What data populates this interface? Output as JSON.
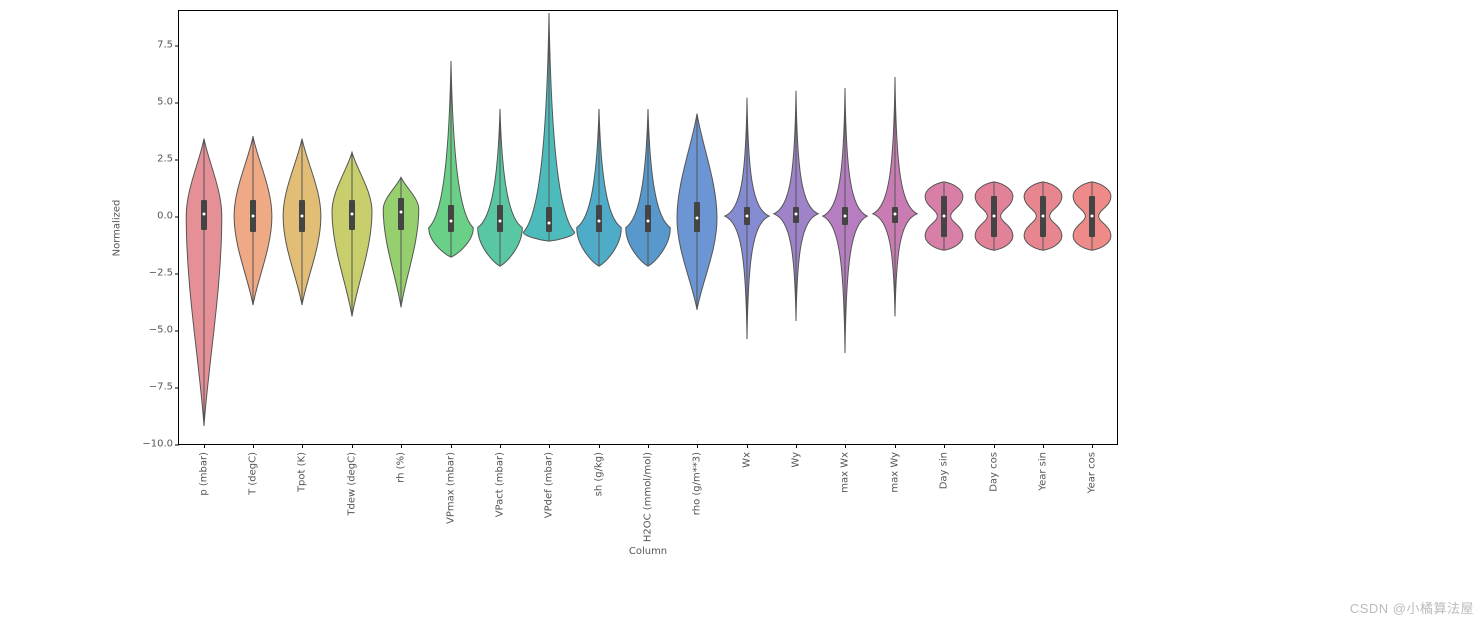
{
  "chart_data": {
    "type": "violin",
    "ylabel": "Normalized",
    "xlabel": "Column",
    "ylim": [
      -10,
      9
    ],
    "yticks": [
      -10.0,
      -7.5,
      -5.0,
      -2.5,
      0.0,
      2.5,
      5.0,
      7.5
    ],
    "ytick_labels": [
      "−10.0",
      "−7.5",
      "−5.0",
      "−2.5",
      "0.0",
      "2.5",
      "5.0",
      "7.5"
    ],
    "categories": [
      "p (mbar)",
      "T (degC)",
      "Tpot (K)",
      "Tdew (degC)",
      "rh (%)",
      "VPmax (mbar)",
      "VPact (mbar)",
      "VPdef (mbar)",
      "sh (g/kg)",
      "H2OC (mmol/mol)",
      "rho (g/m**3)",
      "Wx",
      "Wy",
      "max Wx",
      "max Wy",
      "Day sin",
      "Day cos",
      "Year sin",
      "Year cos"
    ],
    "series": [
      {
        "name": "p (mbar)",
        "color": "#e59097",
        "shape": "sym",
        "min": -9.2,
        "max": 3.4,
        "q1": -0.6,
        "q3": 0.7,
        "median": 0.1,
        "peak_y": 0.0,
        "bulge": 0.8
      },
      {
        "name": "T (degC)",
        "color": "#efa985",
        "shape": "sym",
        "min": -3.9,
        "max": 3.5,
        "q1": -0.7,
        "q3": 0.7,
        "median": 0.0,
        "peak_y": 0.0,
        "bulge": 0.85
      },
      {
        "name": "Tpot (K)",
        "color": "#e2bd76",
        "shape": "sym",
        "min": -3.9,
        "max": 3.4,
        "q1": -0.7,
        "q3": 0.7,
        "median": 0.0,
        "peak_y": 0.0,
        "bulge": 0.85
      },
      {
        "name": "Tdew (degC)",
        "color": "#c8ce6c",
        "shape": "sym",
        "min": -4.4,
        "max": 2.8,
        "q1": -0.6,
        "q3": 0.7,
        "median": 0.1,
        "peak_y": 0.2,
        "bulge": 0.9
      },
      {
        "name": "rh (%)",
        "color": "#96d06e",
        "shape": "sym",
        "min": -4.0,
        "max": 1.7,
        "q1": -0.6,
        "q3": 0.8,
        "median": 0.2,
        "peak_y": 0.3,
        "bulge": 0.8
      },
      {
        "name": "VPmax (mbar)",
        "color": "#6bd087",
        "shape": "lowfat",
        "min": -1.8,
        "max": 6.8,
        "q1": -0.7,
        "q3": 0.5,
        "median": -0.2,
        "peak_y": -0.5,
        "bulge": 1.0
      },
      {
        "name": "VPact (mbar)",
        "color": "#59c7a3",
        "shape": "lowfat",
        "min": -2.2,
        "max": 4.7,
        "q1": -0.7,
        "q3": 0.5,
        "median": -0.2,
        "peak_y": -0.5,
        "bulge": 1.0
      },
      {
        "name": "VPdef (mbar)",
        "color": "#4dbbbc",
        "shape": "lowfat2",
        "min": -1.1,
        "max": 8.9,
        "q1": -0.7,
        "q3": 0.4,
        "median": -0.3,
        "peak_y": -0.7,
        "bulge": 1.15
      },
      {
        "name": "sh (g/kg)",
        "color": "#4eacc8",
        "shape": "lowfat",
        "min": -2.2,
        "max": 4.7,
        "q1": -0.7,
        "q3": 0.5,
        "median": -0.2,
        "peak_y": -0.5,
        "bulge": 1.0
      },
      {
        "name": "H2OC (mmol/mol)",
        "color": "#5898cc",
        "shape": "lowfat",
        "min": -2.2,
        "max": 4.7,
        "q1": -0.7,
        "q3": 0.5,
        "median": -0.2,
        "peak_y": -0.5,
        "bulge": 1.0
      },
      {
        "name": "rho (g/m**3)",
        "color": "#6b95d3",
        "shape": "sym2",
        "min": -4.1,
        "max": 4.5,
        "q1": -0.7,
        "q3": 0.6,
        "median": -0.1,
        "peak_y": -0.1,
        "bulge": 0.9
      },
      {
        "name": "Wx",
        "color": "#858bd1",
        "shape": "center",
        "min": -5.4,
        "max": 5.2,
        "q1": -0.4,
        "q3": 0.4,
        "median": 0.0,
        "peak_y": 0.0,
        "bulge": 1.0
      },
      {
        "name": "Wy",
        "color": "#9f83c9",
        "shape": "center",
        "min": -4.6,
        "max": 5.5,
        "q1": -0.3,
        "q3": 0.4,
        "median": 0.1,
        "peak_y": 0.1,
        "bulge": 1.0
      },
      {
        "name": "max Wx",
        "color": "#b67ec0",
        "shape": "center",
        "min": -6.0,
        "max": 5.6,
        "q1": -0.4,
        "q3": 0.4,
        "median": 0.0,
        "peak_y": 0.0,
        "bulge": 1.0
      },
      {
        "name": "max Wy",
        "color": "#c97cb4",
        "shape": "center",
        "min": -4.4,
        "max": 6.1,
        "q1": -0.3,
        "q3": 0.4,
        "median": 0.1,
        "peak_y": 0.1,
        "bulge": 1.0
      },
      {
        "name": "Day sin",
        "color": "#d87fa7",
        "shape": "bimodal",
        "min": -1.5,
        "max": 1.5,
        "q1": -0.9,
        "q3": 0.9,
        "median": 0.0,
        "peak_y": 0.0,
        "bulge": 0.85
      },
      {
        "name": "Day cos",
        "color": "#e28299",
        "shape": "bimodal",
        "min": -1.5,
        "max": 1.5,
        "q1": -0.9,
        "q3": 0.9,
        "median": 0.0,
        "peak_y": 0.0,
        "bulge": 0.85
      },
      {
        "name": "Year sin",
        "color": "#e8868f",
        "shape": "bimodal",
        "min": -1.5,
        "max": 1.5,
        "q1": -0.9,
        "q3": 0.9,
        "median": 0.0,
        "peak_y": 0.0,
        "bulge": 0.85
      },
      {
        "name": "Year cos",
        "color": "#ee8b88",
        "shape": "bimodal",
        "min": -1.5,
        "max": 1.5,
        "q1": -0.9,
        "q3": 0.9,
        "median": 0.0,
        "peak_y": 0.0,
        "bulge": 0.85
      }
    ]
  },
  "watermark": "CSDN @小橘算法屋"
}
